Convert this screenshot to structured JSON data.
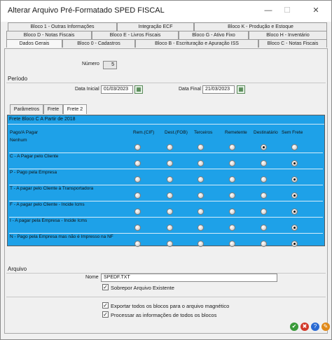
{
  "window": {
    "title": "Alterar Arquivo Pré-Formatado SPED FISCAL",
    "minimize": "—",
    "maximize": "☐",
    "close": "✕"
  },
  "tabs": {
    "row1": [
      "Bloco 1 - Outras Informações",
      "Integração ECF",
      "Bloco K - Produção e Estoque"
    ],
    "row2": [
      "Bloco D - Notas Fiscais",
      "Bloco E - Livros Fiscais",
      "Bloco G - Ativo Fixo",
      "Bloco H - Inventário"
    ],
    "row3": [
      "Dados Gerais",
      "Bloco 0 - Cadastros",
      "Bloco B - Escrituração e Apuração ISS",
      "Bloco C - Notas Fiscais"
    ]
  },
  "numero": {
    "label": "Número",
    "value": "5"
  },
  "periodo": {
    "section": "Período",
    "inicial_label": "Data Inicial",
    "inicial_value": "01/03/2023",
    "final_label": "Data Final",
    "final_value": "21/03/2023"
  },
  "subtabs": [
    "Parâmetros",
    "Frete",
    "Frete 2"
  ],
  "frete": {
    "header": "Frete Bloco C A Partir de 2018",
    "question": "Pago/A Pagar",
    "columns": [
      "Rem.(CIF)",
      "Dest.(FOB)",
      "Terceiros",
      "Remetente",
      "Destinatário",
      "Sem Frete"
    ],
    "rows": [
      {
        "label": "Nenhum",
        "selected": 4
      },
      {
        "label": "C - A Pagar pelo Cliente",
        "selected": 5
      },
      {
        "label": "P - Pago pela Empresa",
        "selected": 5
      },
      {
        "label": "T - A pagar pelo Cliente à Transportadora",
        "selected": 5
      },
      {
        "label": "F - A pagar pelo Cliente - Incide Icms",
        "selected": 5
      },
      {
        "label": "I - A pagar pela Empresa - Incide Icms",
        "selected": 5
      },
      {
        "label": "N - Pago pela Empresa mas não é Impresso na NF",
        "selected": 5
      }
    ],
    "accent": "#1ea1e8"
  },
  "arquivo": {
    "section": "Arquivo",
    "nome_label": "Nome",
    "nome_value": "SPEDF.TXT",
    "sobrepor_label": "Sobrepor Arquivo Existente",
    "sobrepor_checked": true
  },
  "exportar": {
    "label": "Exportar todos os blocos para o arquivo magnético",
    "checked": true
  },
  "processar": {
    "label": "Processar as informações de todos os blocos",
    "checked": true
  },
  "actions": [
    {
      "icon": "confirm-icon",
      "glyph": "✔",
      "color": "#3a9a3a"
    },
    {
      "icon": "cancel-icon",
      "glyph": "✖",
      "color": "#d23a2a"
    },
    {
      "icon": "help-icon",
      "glyph": "?",
      "color": "#2a6ad2"
    },
    {
      "icon": "tools-icon",
      "glyph": "✎",
      "color": "#e08a1a"
    }
  ]
}
